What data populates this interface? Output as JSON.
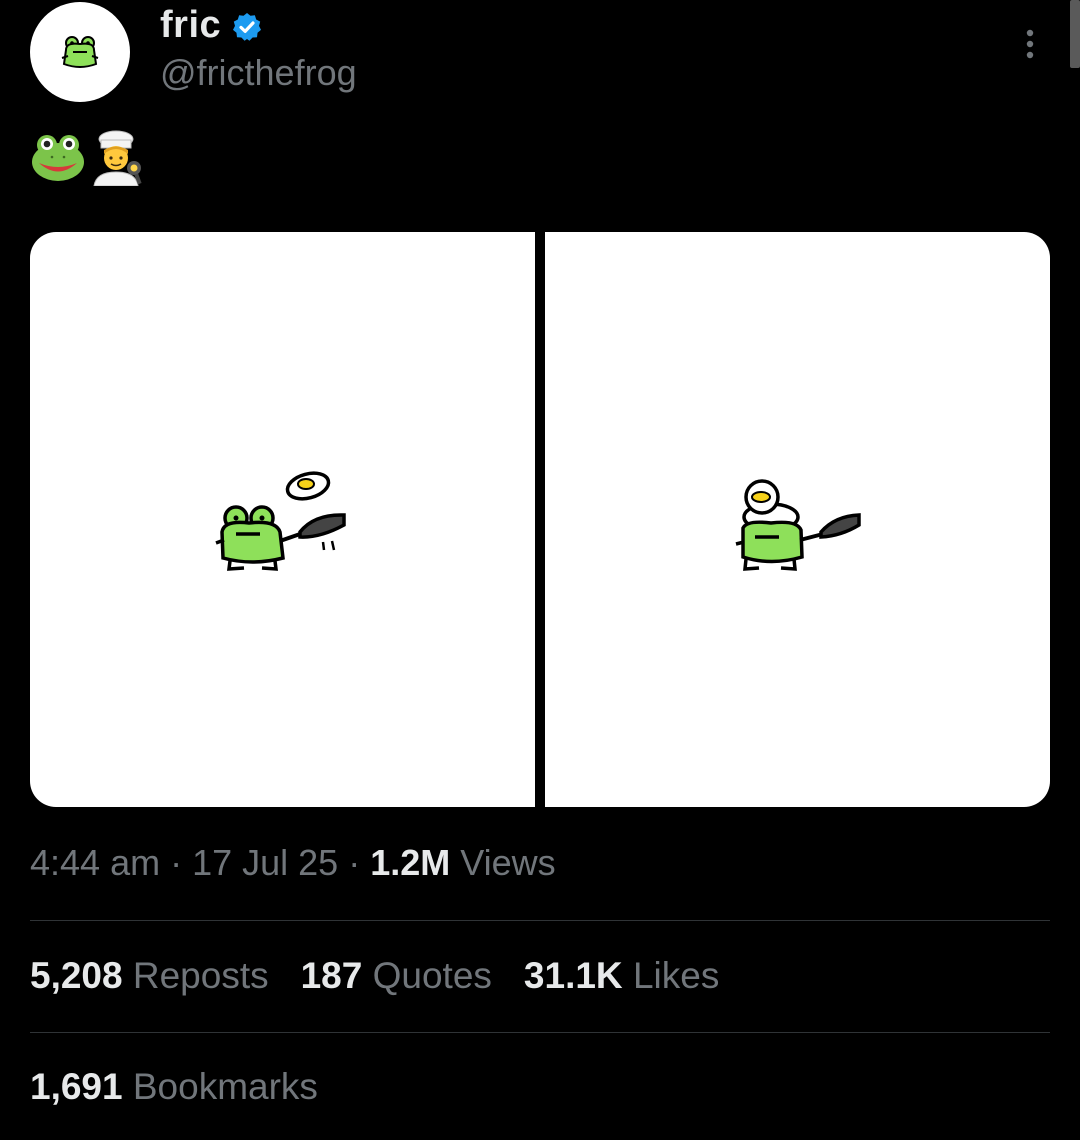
{
  "author": {
    "display_name": "fric",
    "handle": "@fricthefrog",
    "verified": true,
    "avatar_icon": "frog-avatar-icon"
  },
  "post": {
    "emojis": [
      "frog-face-emoji",
      "cook-emoji"
    ],
    "images": [
      {
        "icon": "frog-flipping-egg-drawing"
      },
      {
        "icon": "frog-with-egg-on-head-drawing"
      }
    ]
  },
  "meta": {
    "time": "4:44 am",
    "sep1": " · ",
    "date": "17 Jul 25",
    "sep2": " · ",
    "views_count": "1.2M",
    "views_label": " Views"
  },
  "stats": {
    "reposts_count": "5,208",
    "reposts_label": "Reposts",
    "quotes_count": "187",
    "quotes_label": "Quotes",
    "likes_count": "31.1K",
    "likes_label": "Likes",
    "bookmarks_count": "1,691",
    "bookmarks_label": "Bookmarks"
  },
  "colors": {
    "background": "#000000",
    "primary_text": "#e7e9ea",
    "secondary_text": "#71767b",
    "verified_blue": "#1d9bf0",
    "frog_green": "#8ee05a",
    "divider": "#2f3336"
  }
}
